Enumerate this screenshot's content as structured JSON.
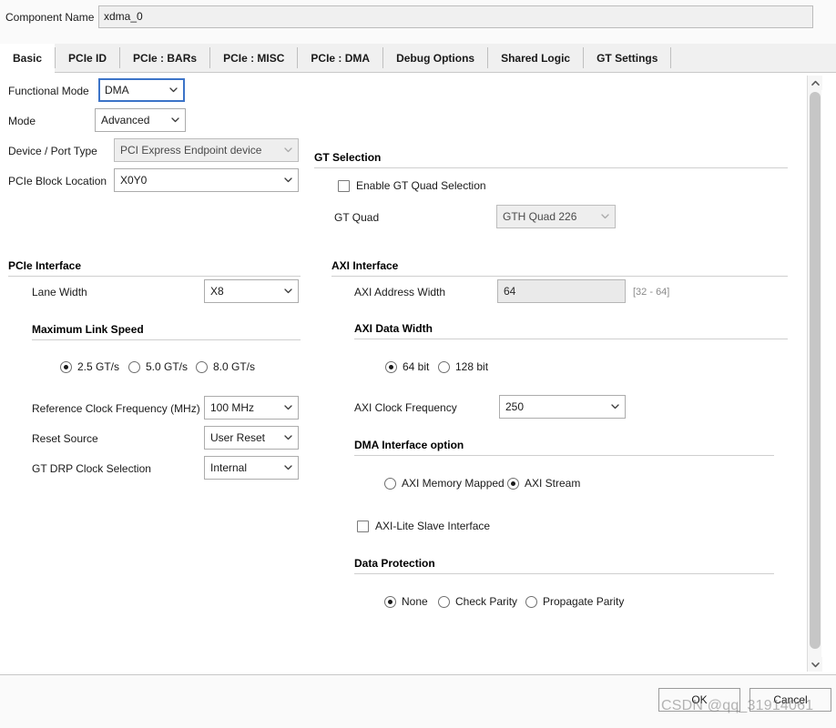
{
  "component": {
    "label": "Component Name",
    "value": "xdma_0"
  },
  "tabs": [
    {
      "label": "Basic",
      "active": true
    },
    {
      "label": "PCIe ID",
      "active": false
    },
    {
      "label": "PCIe : BARs",
      "active": false
    },
    {
      "label": "PCIe : MISC",
      "active": false
    },
    {
      "label": "PCIe : DMA",
      "active": false
    },
    {
      "label": "Debug Options",
      "active": false
    },
    {
      "label": "Shared Logic",
      "active": false
    },
    {
      "label": "GT Settings",
      "active": false
    }
  ],
  "left": {
    "functional_mode": {
      "label": "Functional Mode",
      "value": "DMA"
    },
    "mode": {
      "label": "Mode",
      "value": "Advanced"
    },
    "device_port_type": {
      "label": "Device / Port Type",
      "value": "PCI Express Endpoint device"
    },
    "pcie_block_location": {
      "label": "PCIe Block Location",
      "value": "X0Y0"
    },
    "pcie_interface_title": "PCIe Interface",
    "lane_width": {
      "label": "Lane Width",
      "value": "X8"
    },
    "max_link_speed_title": "Maximum Link Speed",
    "max_link_speed_options": [
      {
        "label": "2.5 GT/s",
        "selected": true
      },
      {
        "label": "5.0 GT/s",
        "selected": false
      },
      {
        "label": "8.0 GT/s",
        "selected": false
      }
    ],
    "ref_clock": {
      "label": "Reference Clock Frequency (MHz)",
      "value": "100 MHz"
    },
    "reset_source": {
      "label": "Reset Source",
      "value": "User Reset"
    },
    "gt_drp_clock": {
      "label": "GT DRP Clock Selection",
      "value": "Internal"
    }
  },
  "right": {
    "gt_selection_title": "GT Selection",
    "enable_gt_quad": {
      "label": "Enable GT Quad Selection",
      "checked": false
    },
    "gt_quad": {
      "label": "GT Quad",
      "value": "GTH Quad 226"
    },
    "axi_interface_title": "AXI Interface",
    "axi_address_width": {
      "label": "AXI Address Width",
      "value": "64",
      "range": "[32 - 64]"
    },
    "axi_data_width_title": "AXI Data Width",
    "axi_data_width_options": [
      {
        "label": "64 bit",
        "selected": true
      },
      {
        "label": "128 bit",
        "selected": false
      }
    ],
    "axi_clock_frequency": {
      "label": "AXI Clock Frequency",
      "value": "250"
    },
    "dma_interface_title": "DMA Interface option",
    "dma_interface_options": [
      {
        "label": "AXI Memory Mapped",
        "selected": false
      },
      {
        "label": "AXI Stream",
        "selected": true
      }
    ],
    "axi_lite_slave": {
      "label": "AXI-Lite Slave Interface",
      "checked": false
    },
    "data_protection_title": "Data Protection",
    "data_protection_options": [
      {
        "label": "None",
        "selected": true
      },
      {
        "label": "Check Parity",
        "selected": false
      },
      {
        "label": "Propagate Parity",
        "selected": false
      }
    ]
  },
  "footer": {
    "ok": "OK",
    "cancel": "Cancel"
  },
  "watermark": "CSDN @qq_31914061",
  "icons": {
    "chevron_down": "chevron-down-icon",
    "scroll_up": "˄",
    "scroll_down": "˅"
  }
}
